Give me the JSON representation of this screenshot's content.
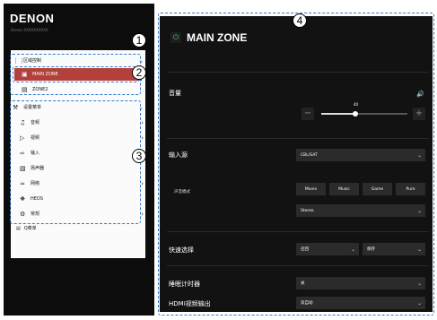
{
  "brand": {
    "name": "DENON",
    "serial": "Denon XXXXXXXXXX"
  },
  "sidebar": {
    "zone_control": {
      "label": "区域控制"
    },
    "zones": [
      {
        "label": "MAIN ZONE",
        "icon": "speaker-zone-icon"
      },
      {
        "label": "ZONE2",
        "icon": "speaker-zone-icon"
      }
    ],
    "settings": {
      "label": "设置菜单"
    },
    "items": [
      {
        "label": "音频",
        "icon": "music-note-icon",
        "has_children": true
      },
      {
        "label": "视频",
        "icon": "video-icon",
        "has_children": true
      },
      {
        "label": "输入",
        "icon": "input-icon",
        "has_children": true
      },
      {
        "label": "扬声器",
        "icon": "speakers-icon",
        "has_children": false
      },
      {
        "label": "网络",
        "icon": "wifi-icon",
        "has_children": true
      },
      {
        "label": "HEOS",
        "icon": "heos-icon",
        "has_children": false
      },
      {
        "label": "常规",
        "icon": "gear-icon",
        "has_children": true
      }
    ],
    "menu": {
      "label": "Q菜单"
    }
  },
  "callouts": [
    "1",
    "2",
    "3",
    "4"
  ],
  "main": {
    "zone_title": "MAIN ZONE",
    "volume": {
      "label": "音量",
      "value": "40",
      "level": 0.4,
      "minus": "−",
      "plus": "+"
    },
    "input": {
      "label": "输入源",
      "value": "CBL/SAT"
    },
    "sound_mode": {
      "label": "声音模式",
      "buttons": [
        "Movie",
        "Music",
        "Game",
        "Pure"
      ],
      "value": "Stereo"
    },
    "quick_select": {
      "label": "快速选择",
      "value": "召回",
      "action": "保存"
    },
    "sleep_timer": {
      "label": "睡眠计时器",
      "value": "关"
    },
    "hdmi_output": {
      "label": "HDMI视频输出",
      "value": "双自动"
    }
  },
  "colors": {
    "accent_red": "#b3403a",
    "callout_dash": "#2f7bd0",
    "power_green": "#3ecb5b"
  }
}
